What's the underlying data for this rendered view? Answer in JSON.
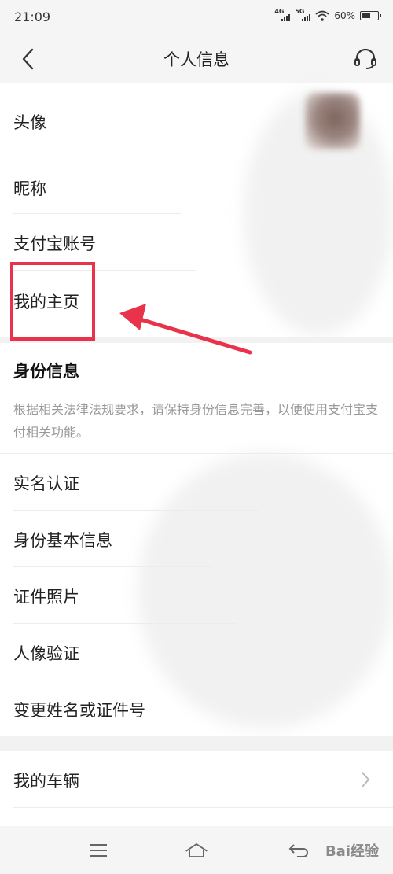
{
  "status_bar": {
    "time": "21:09",
    "net1": "4G",
    "net2": "5G",
    "battery": "60%",
    "battery_level": 0.6
  },
  "header": {
    "title": "个人信息"
  },
  "profile_items": [
    {
      "label": "头像"
    },
    {
      "label": "昵称"
    },
    {
      "label": "支付宝账号"
    },
    {
      "label": "我的主页"
    }
  ],
  "identity_section": {
    "title": "身份信息",
    "description": "根据相关法律法规要求，请保持身份信息完善，以便使用支付宝支付相关功能。",
    "items": [
      {
        "label": "实名认证"
      },
      {
        "label": "身份基本信息"
      },
      {
        "label": "证件照片"
      },
      {
        "label": "人像验证"
      },
      {
        "label": "变更姓名或证件号"
      }
    ]
  },
  "other_items": [
    {
      "label": "我的车辆"
    }
  ],
  "watermark": "Bai经验",
  "colors": {
    "highlight": "#e8334a",
    "background": "#f2f2f2"
  }
}
